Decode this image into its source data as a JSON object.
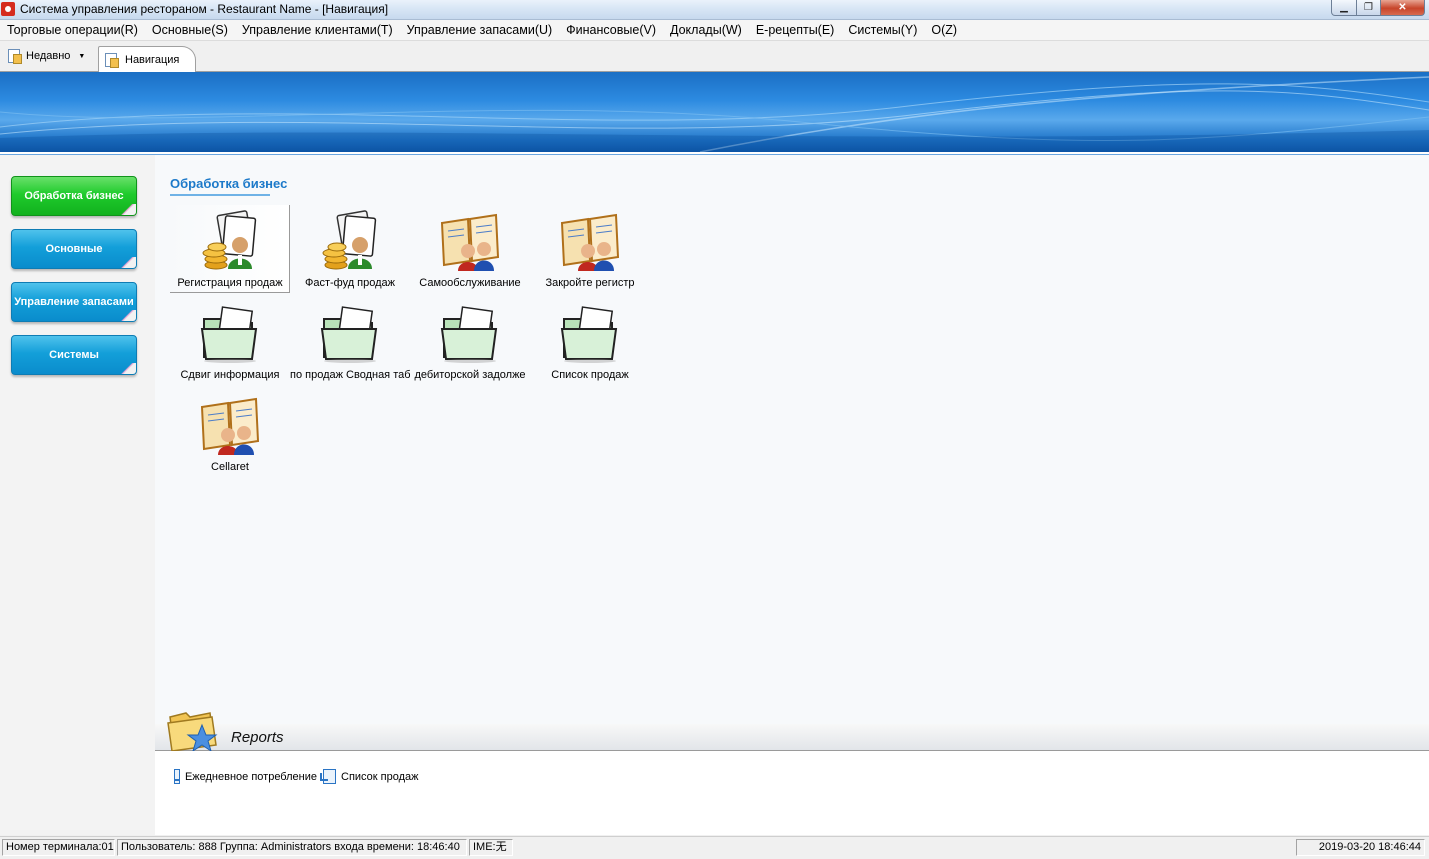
{
  "window": {
    "title": "Система управления рестораном  - Restaurant Name - [Навигация]",
    "min_label": "▁",
    "max_label": "❐",
    "close_label": "✕"
  },
  "menu": [
    "Торговые операции(R)",
    "Основные(S)",
    "Управление клиентами(T)",
    "Управление запасами(U)",
    "Финансовые(V)",
    "Доклады(W)",
    "E-рецепты(E)",
    "Системы(Y)",
    "O(Z)"
  ],
  "tabs": {
    "recent_label": "Недавно",
    "active_tab": "Навигация"
  },
  "sidebar": {
    "items": [
      {
        "label": "Обработка бизнес",
        "active": true
      },
      {
        "label": "Основные",
        "active": false
      },
      {
        "label": "Управление запасами",
        "active": false
      },
      {
        "label": "Системы",
        "active": false
      }
    ]
  },
  "section": {
    "title": "Обработка бизнес",
    "tiles": [
      {
        "label": "Регистрация продаж",
        "icon": "cashier-coins-icon"
      },
      {
        "label": "Фаст-фуд продаж",
        "icon": "cashier-coins-icon"
      },
      {
        "label": "Самообслуживание",
        "icon": "book-people-icon"
      },
      {
        "label": "Закройте регистр",
        "icon": "book-people-icon"
      },
      {
        "label": "Сдвиг информация",
        "icon": "folder-icon"
      },
      {
        "label": "по продаж Сводная табл",
        "icon": "folder-icon"
      },
      {
        "label": "дебиторской задолже",
        "icon": "folder-icon"
      },
      {
        "label": "Список продаж",
        "icon": "folder-icon"
      },
      {
        "label": "Cellaret",
        "icon": "book-people-icon"
      }
    ]
  },
  "reports": {
    "title": "Reports",
    "links": [
      "Ежедневное потребление",
      "Список продаж"
    ]
  },
  "status": {
    "terminal": "Номер терминала:01",
    "user": "Пользователь: 888 Группа: Administrators входа времени: 18:46:40",
    "ime": "IME:无",
    "datetime": "2019-03-20 18:46:44"
  }
}
